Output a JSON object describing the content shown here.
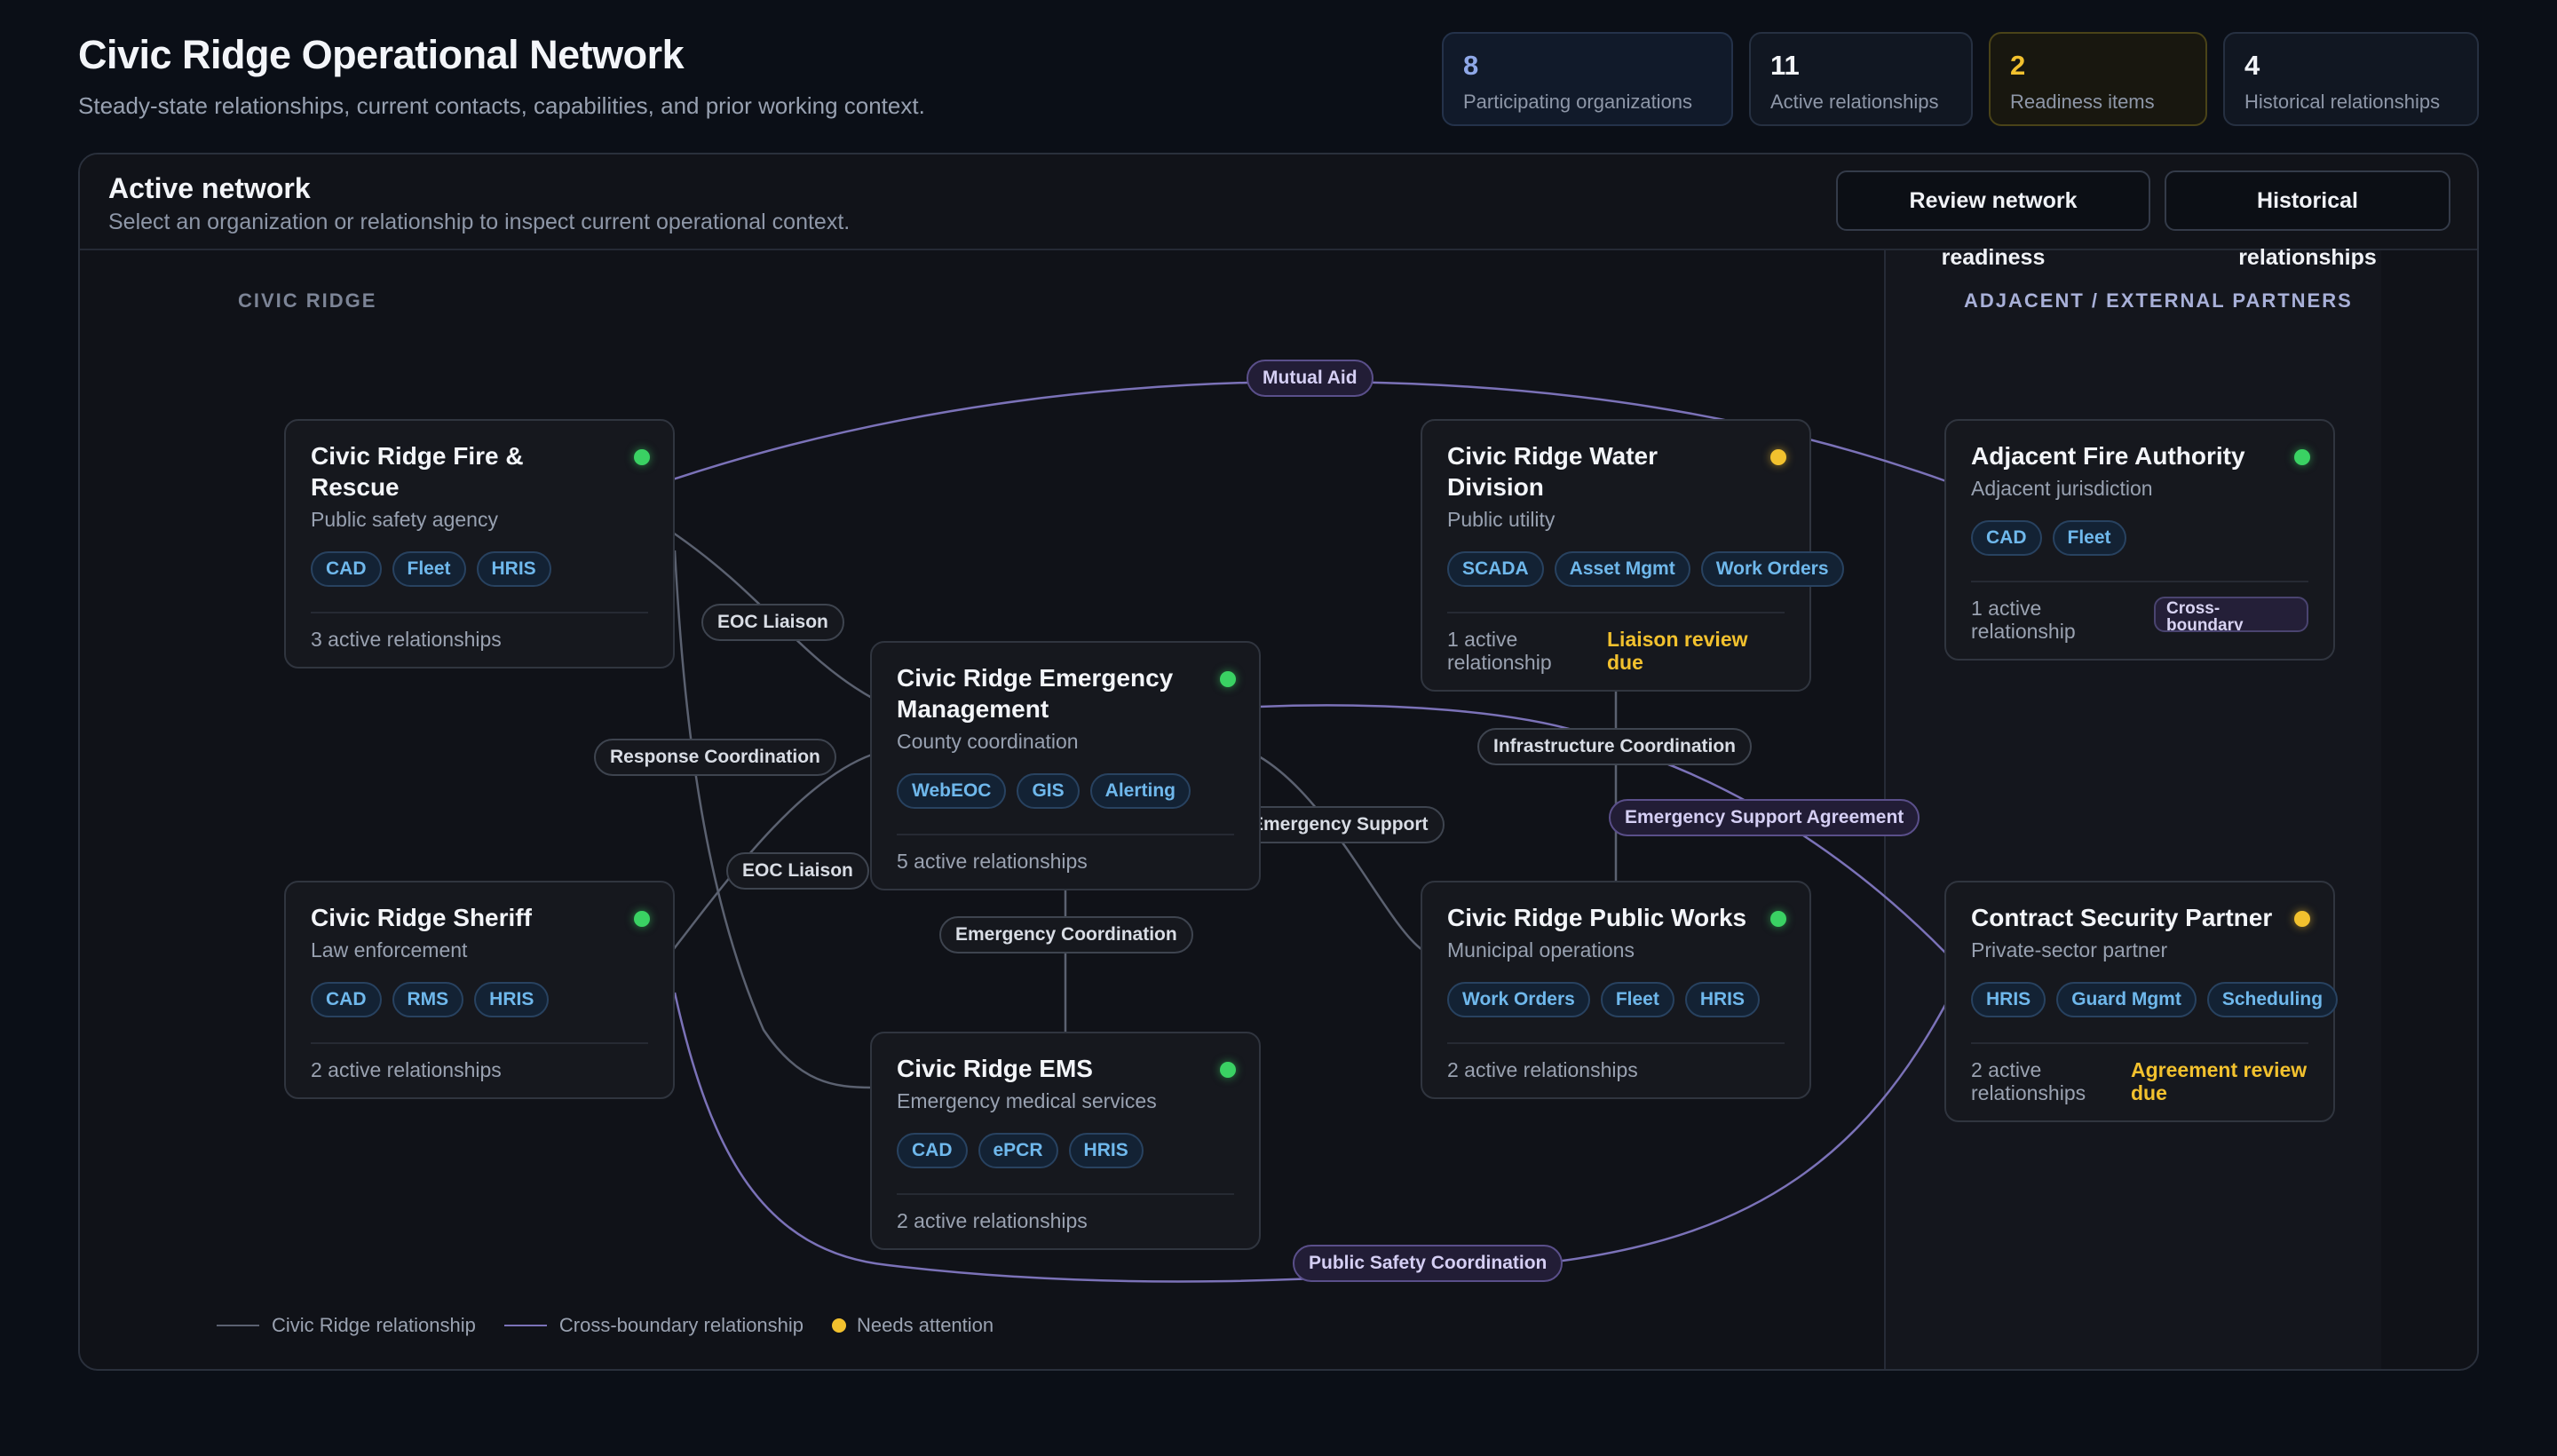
{
  "header": {
    "title": "Civic Ridge Operational Network",
    "subtitle": "Steady-state relationships, current contacts, capabilities, and prior working context."
  },
  "stats": [
    {
      "value": "8",
      "label": "Participating organizations"
    },
    {
      "value": "11",
      "label": "Active relationships"
    },
    {
      "value": "2",
      "label": "Readiness items"
    },
    {
      "value": "4",
      "label": "Historical relationships"
    }
  ],
  "panel": {
    "title": "Active network",
    "subtitle": "Select an organization or relationship to inspect current operational context.",
    "review_button": "Review network readiness",
    "history_button": "Historical relationships",
    "section_internal": "CIVIC RIDGE",
    "section_external": "ADJACENT / EXTERNAL PARTNERS"
  },
  "nodes": {
    "fire": {
      "title": "Civic Ridge Fire & Rescue",
      "type": "Public safety agency",
      "tags": [
        "CAD",
        "Fleet",
        "HRIS"
      ],
      "count": "3 active relationships",
      "status": "ok"
    },
    "water": {
      "title": "Civic Ridge Water Division",
      "type": "Public utility",
      "tags": [
        "SCADA",
        "Asset Mgmt",
        "Work Orders"
      ],
      "count": "1 active relationship",
      "note": "Liaison review due",
      "status": "attention"
    },
    "adjfire": {
      "title": "Adjacent Fire Authority",
      "type": "Adjacent jurisdiction",
      "tags": [
        "CAD",
        "Fleet"
      ],
      "count": "1 active relationship",
      "badge": "Cross-boundary",
      "status": "ok"
    },
    "em": {
      "title": "Civic Ridge Emergency Management",
      "type": "County coordination",
      "tags": [
        "WebEOC",
        "GIS",
        "Alerting"
      ],
      "count": "5 active relationships",
      "status": "ok"
    },
    "sheriff": {
      "title": "Civic Ridge Sheriff",
      "type": "Law enforcement",
      "tags": [
        "CAD",
        "RMS",
        "HRIS"
      ],
      "count": "2 active relationships",
      "status": "ok"
    },
    "pw": {
      "title": "Civic Ridge Public Works",
      "type": "Municipal operations",
      "tags": [
        "Work Orders",
        "Fleet",
        "HRIS"
      ],
      "count": "2 active relationships",
      "status": "ok"
    },
    "security": {
      "title": "Contract Security Partner",
      "type": "Private-sector partner",
      "tags": [
        "HRIS",
        "Guard Mgmt",
        "Scheduling"
      ],
      "count": "2 active relationships",
      "note": "Agreement review due",
      "status": "attention"
    },
    "ems": {
      "title": "Civic Ridge EMS",
      "type": "Emergency medical services",
      "tags": [
        "CAD",
        "ePCR",
        "HRIS"
      ],
      "count": "2 active relationships",
      "status": "ok"
    }
  },
  "relationships": {
    "mutual_aid": "Mutual Aid",
    "eoc_liaison_fire": "EOC Liaison",
    "response_coordination": "Response Coordination",
    "eoc_liaison_sheriff": "EOC Liaison",
    "infrastructure_coordination": "Infrastructure Coordination",
    "emergency_support_agreement": "Emergency Support Agreement",
    "emergency_support": "Emergency Support",
    "emergency_coordination": "Emergency Coordination",
    "public_safety_coordination": "Public Safety Coordination"
  },
  "legend": {
    "internal": "Civic Ridge relationship",
    "cross": "Cross-boundary relationship",
    "attention": "Needs attention"
  },
  "colors": {
    "background": "#0b0f17",
    "internal_edge": "#5b6170",
    "cross_edge": "#7b72b8",
    "ok": "#3ad163",
    "attention": "#f2c12e",
    "tag": "#6fb8ec"
  }
}
